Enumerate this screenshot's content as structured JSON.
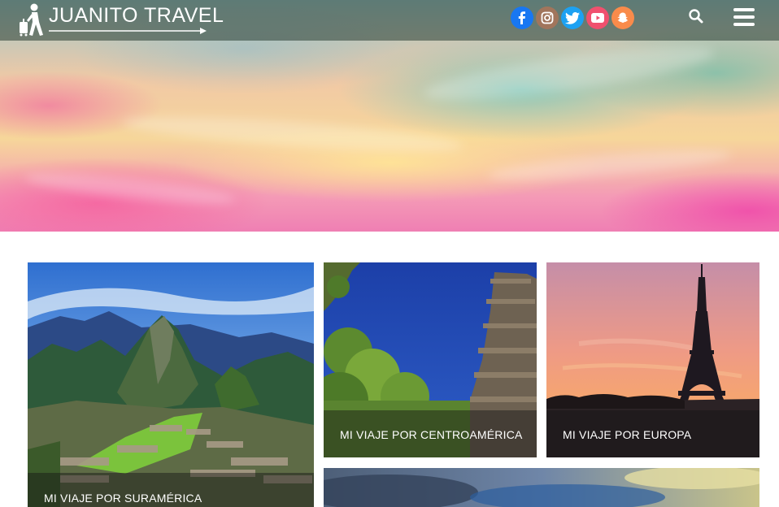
{
  "header": {
    "logo_text": "JUANITO TRAVEL",
    "social": [
      {
        "name": "facebook",
        "glyph": "f",
        "color": "#1877f2"
      },
      {
        "name": "instagram",
        "glyph": "◎",
        "color": "#a1755c"
      },
      {
        "name": "twitter",
        "glyph": "🐦",
        "color": "#1da1f2"
      },
      {
        "name": "youtube",
        "glyph": "▶",
        "color": "#f0506e"
      },
      {
        "name": "snapchat",
        "glyph": "👻",
        "color": "#f98b4b"
      }
    ]
  },
  "cards": {
    "suramerica": "MI VIAJE POR SURAMÉRICA",
    "centroamerica": "MI VIAJE POR CENTROAMÉRICA",
    "europa": "MI VIAJE POR EUROPA"
  }
}
